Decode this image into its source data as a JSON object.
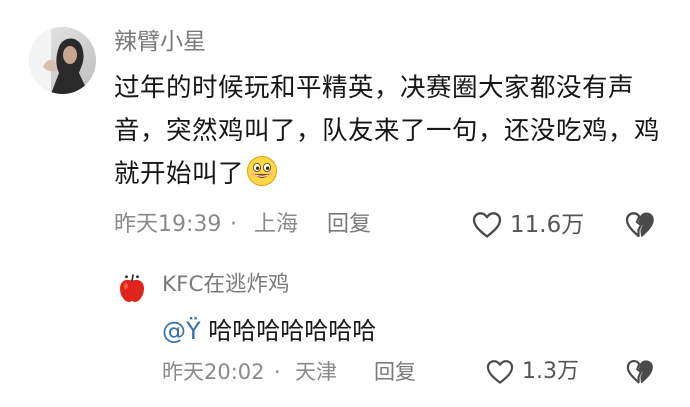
{
  "main_comment": {
    "username": "辣臂小星",
    "content": "过年的时候玩和平精英，决赛圈大家都没有声音，突然鸡叫了，队友来了一句，还没吃鸡，鸡就开始叫了",
    "emoji_icon": "grinning-face-emoji",
    "time": "昨天19:39",
    "separator": "·",
    "location": "上海",
    "reply_label": "回复",
    "like_count": "11.6万"
  },
  "sub_reply": {
    "username": "KFC在逃炸鸡",
    "mention": "@Ÿ",
    "content": " 哈哈哈哈哈哈哈",
    "time": "昨天20:02",
    "separator": "·",
    "location": "天津",
    "reply_label": "回复",
    "like_count": "1.3万"
  },
  "icons": {
    "like": "heart-outline-icon",
    "dislike": "broken-heart-icon"
  },
  "colors": {
    "text_primary": "#161616",
    "text_secondary": "#8a8a8a",
    "mention": "#3d6ea8",
    "sub_avatar": "#e0231b"
  }
}
